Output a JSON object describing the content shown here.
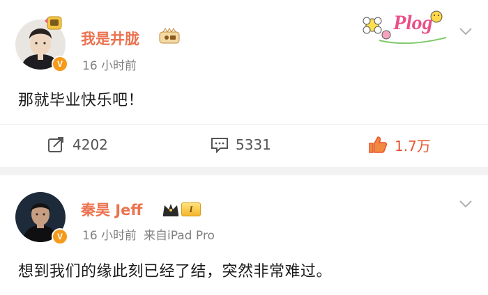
{
  "posts": [
    {
      "user_name": "我是井胧",
      "time": "16 小时前",
      "source": "",
      "text": "那就毕业快乐吧！",
      "sticker_text": "Plog",
      "actions": {
        "repost_count": "4202",
        "comment_count": "5331",
        "like_count": "1.7万"
      }
    },
    {
      "user_name": "秦昊 Jeff",
      "time": "16 小时前",
      "source": "来自iPad Pro",
      "text": "想到我们的缘此刻已经了结，突然非常难过。",
      "level_badge": "I"
    }
  ],
  "verified_badge": "V",
  "colors": {
    "name": "#eb7350",
    "like": "#e8542d",
    "verified": "#f59a1b",
    "meta": "#808080"
  },
  "icons": [
    "repost-icon",
    "comment-icon",
    "like-icon",
    "chevron-down-icon",
    "crown-icon"
  ]
}
